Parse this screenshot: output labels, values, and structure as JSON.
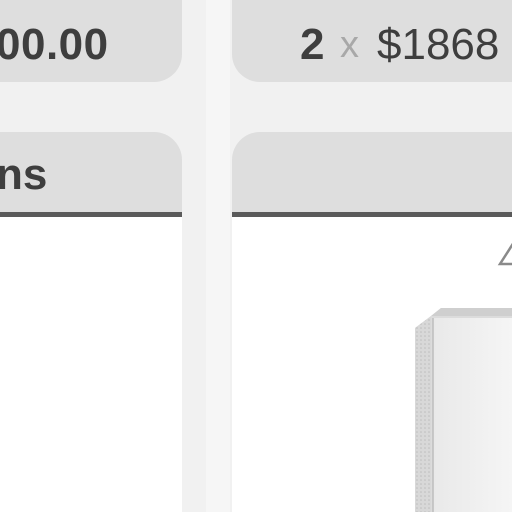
{
  "left_card": {
    "price": "00.00",
    "header_title": "ns"
  },
  "right_card": {
    "quantity": "2",
    "times_symbol": "x",
    "unit_price": "$1868"
  },
  "colors": {
    "background": "#f1f1f1",
    "panel": "#dedede",
    "divider": "#5a5a5a",
    "text": "#3e3e3e",
    "muted": "#a8a8a8",
    "card_body": "#ffffff"
  },
  "icons": {
    "product": "appliance-image",
    "partial_digit": "partial-number-icon"
  }
}
